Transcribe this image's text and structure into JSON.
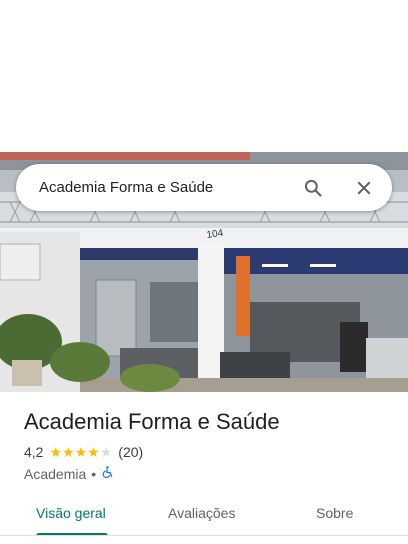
{
  "search": {
    "query": "Academia Forma e Saúde"
  },
  "place": {
    "name": "Academia Forma e Saúde",
    "rating": "4,2",
    "stars_filled": 4,
    "stars_total": 5,
    "review_count": "(20)",
    "category": "Academia",
    "separator": "•",
    "accessibility_icon": "wheelchair-icon"
  },
  "photo": {
    "building_number": "104"
  },
  "tabs": [
    {
      "label": "Visão geral",
      "selected": true
    },
    {
      "label": "Avaliações",
      "selected": false
    },
    {
      "label": "Sobre",
      "selected": false
    }
  ],
  "colors": {
    "accent": "#00796b",
    "star": "#fbbc04",
    "accessibility": "#1a73e8"
  }
}
